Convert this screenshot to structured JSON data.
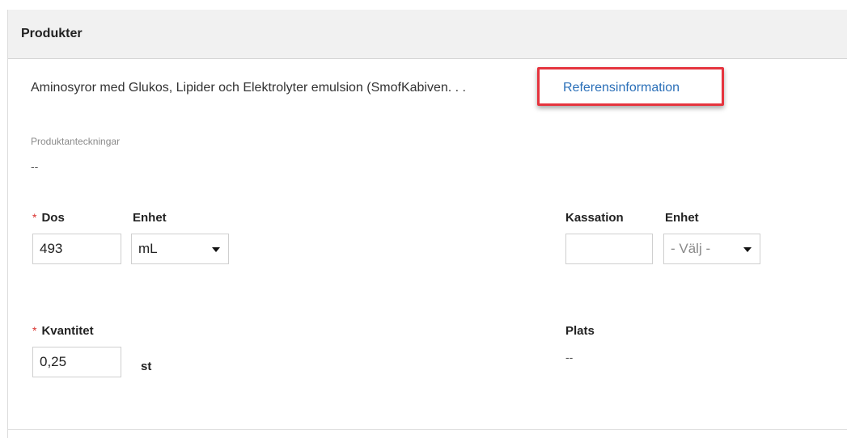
{
  "panel": {
    "title": "Produkter"
  },
  "product": {
    "name": "Aminosyror med Glukos, Lipider och Elektrolyter emulsion (SmofKabiven. . .",
    "reference_link": "Referensinformation"
  },
  "notes": {
    "label": "Produktanteckningar",
    "value": "--"
  },
  "dose": {
    "required_marker": "*",
    "label": "Dos",
    "value": "493",
    "unit_label": "Enhet",
    "unit_value": "mL"
  },
  "discard": {
    "label": "Kassation",
    "value": "",
    "unit_label": "Enhet",
    "unit_value": "- Välj -"
  },
  "quantity": {
    "required_marker": "*",
    "label": "Kvantitet",
    "value": "0,25",
    "unit": "st"
  },
  "location": {
    "label": "Plats",
    "value": "--"
  },
  "colors": {
    "highlight_border": "#e5343e",
    "link": "#2a6fb8",
    "required": "#d9302d",
    "header_bg": "#f1f1f1"
  },
  "icons": {
    "dropdown": "chevron-down-icon"
  }
}
